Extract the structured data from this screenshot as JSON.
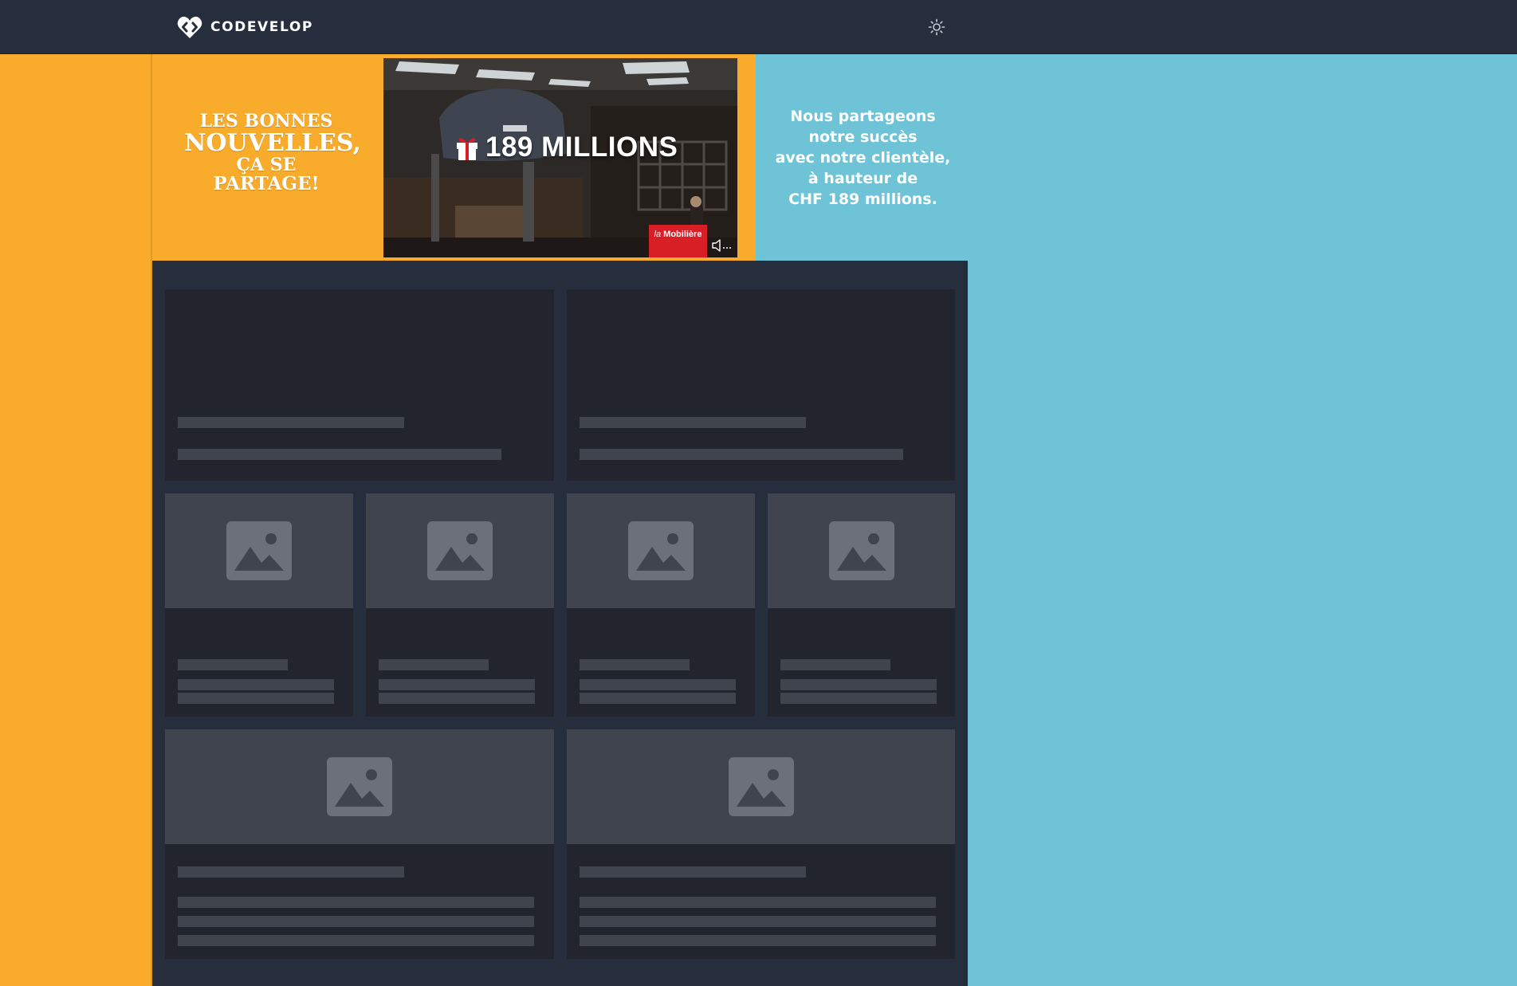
{
  "topbar": {
    "logo_text": "CODEVELOP",
    "logo_icon": "heart-code-icon",
    "theme_icon": "sun-icon"
  },
  "colors": {
    "topbar": "#262d3d",
    "ad_orange": "#f9ac2b",
    "ad_blue": "#6fc3d6",
    "skeleton_card": "#22252d",
    "skeleton_fill": "#40444e",
    "brand_red": "#d91f26"
  },
  "ad": {
    "slogan": [
      "LES BONNES",
      "NOUVELLES,",
      "ÇA SE",
      "PARTAGE!"
    ],
    "headline": "189 MILLIONS",
    "brand_prefix": "la",
    "brand_name": "Mobilière",
    "copy": [
      "Nous partageons",
      "notre succès",
      "avec notre clientèle,",
      "à hauteur de",
      "CHF 189 millions."
    ],
    "headline_icon": "gift-icon",
    "sound_icon": "speaker-muted-icon"
  },
  "skeleton": {
    "placeholder_icon": "image-placeholder-icon",
    "loading": true
  }
}
